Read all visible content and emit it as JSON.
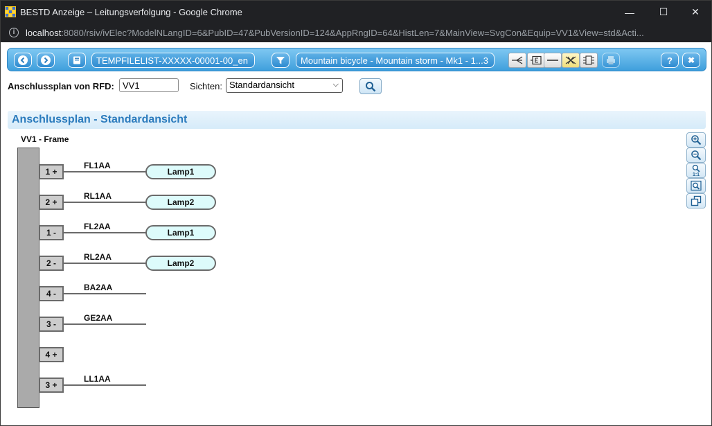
{
  "window": {
    "title": "BESTD Anzeige – Leitungsverfolgung - Google Chrome",
    "minimize_glyph": "—",
    "maximize_glyph": "☐",
    "close_glyph": "✕"
  },
  "address": {
    "host": "localhost",
    "rest": ":8080/rsiv/ivElec?ModelNLangID=6&PubID=47&PubVersionID=124&AppRngID=64&HistLen=7&MainView=SvgCon&Equip=VV1&View=std&Acti..."
  },
  "toolbar": {
    "filelist": "TEMPFILELIST-XXXXX-00001-00_en",
    "vehicle": "Mountain bicycle - Mountain storm - Mk1 - 1...3",
    "help_glyph": "?",
    "close_glyph": "✖"
  },
  "search": {
    "rfd_label": "Anschlussplan von RFD:",
    "rfd_value": "VV1",
    "views_label": "Sichten:",
    "views_selected": "Standardansicht"
  },
  "section": {
    "title": "Anschlussplan - Standardansicht"
  },
  "diagram": {
    "frame_label": "VV1 - Frame",
    "pins": [
      {
        "pin": "1 +",
        "wire": "FL1AA",
        "lamp": "Lamp1"
      },
      {
        "pin": "2 +",
        "wire": "RL1AA",
        "lamp": "Lamp2"
      },
      {
        "pin": "1 -",
        "wire": "FL2AA",
        "lamp": "Lamp1"
      },
      {
        "pin": "2 -",
        "wire": "RL2AA",
        "lamp": "Lamp2"
      },
      {
        "pin": "4 -",
        "wire": "BA2AA",
        "lamp": ""
      },
      {
        "pin": "3 -",
        "wire": "GE2AA",
        "lamp": ""
      },
      {
        "pin": "4 +",
        "wire": "",
        "lamp": ""
      },
      {
        "pin": "3 +",
        "wire": "LL1AA",
        "lamp": ""
      }
    ]
  },
  "zoom_tools": {
    "reset_label": "1:1"
  }
}
